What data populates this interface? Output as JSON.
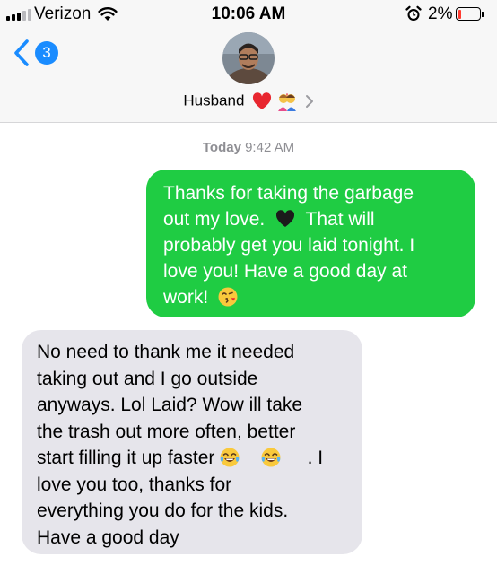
{
  "status_bar": {
    "carrier": "Verizon",
    "time": "10:06 AM",
    "battery_percent": "2%",
    "battery_level": 0.02,
    "signal_bars_filled": 3,
    "signal_bars_total": 5,
    "icons": [
      "signal-icon",
      "wifi-icon",
      "alarm-icon",
      "battery-icon"
    ]
  },
  "nav": {
    "unread_count": "3",
    "contact_name": "Husband",
    "contact_icons": [
      "heart-icon",
      "couple-icon",
      "chevron-right-icon"
    ]
  },
  "conversation": {
    "timestamp_day": "Today",
    "timestamp_time": "9:42 AM",
    "sent": {
      "line1": "Thanks for taking the garbage",
      "line2a": "out my love.",
      "line2b": "That will",
      "line3": "probably get you laid tonight. I",
      "line4": "love you! Have a good day at",
      "line5": "work!",
      "emojis": [
        "black-heart-emoji",
        "kiss-emoji"
      ]
    },
    "received": {
      "line1": "No need to thank me it needed",
      "line2": "taking out and I go outside",
      "line3": "anyways. Lol Laid? Wow ill take",
      "line4": "the trash out more often, better",
      "line5": "start filling it up faster",
      "line5end": ". I",
      "line6": "love you too, thanks for",
      "line7": "everything you do for the kids.",
      "line8": "Have a good day",
      "emojis": [
        "tears-of-joy-emoji",
        "tears-of-joy-emoji"
      ]
    }
  },
  "colors": {
    "sent_bubble": "#1fcc43",
    "received_bubble": "#e6e5eb",
    "accent_blue": "#1a8cff",
    "battery_low": "#ff3b30",
    "timestamp_gray": "#8e8e93"
  }
}
